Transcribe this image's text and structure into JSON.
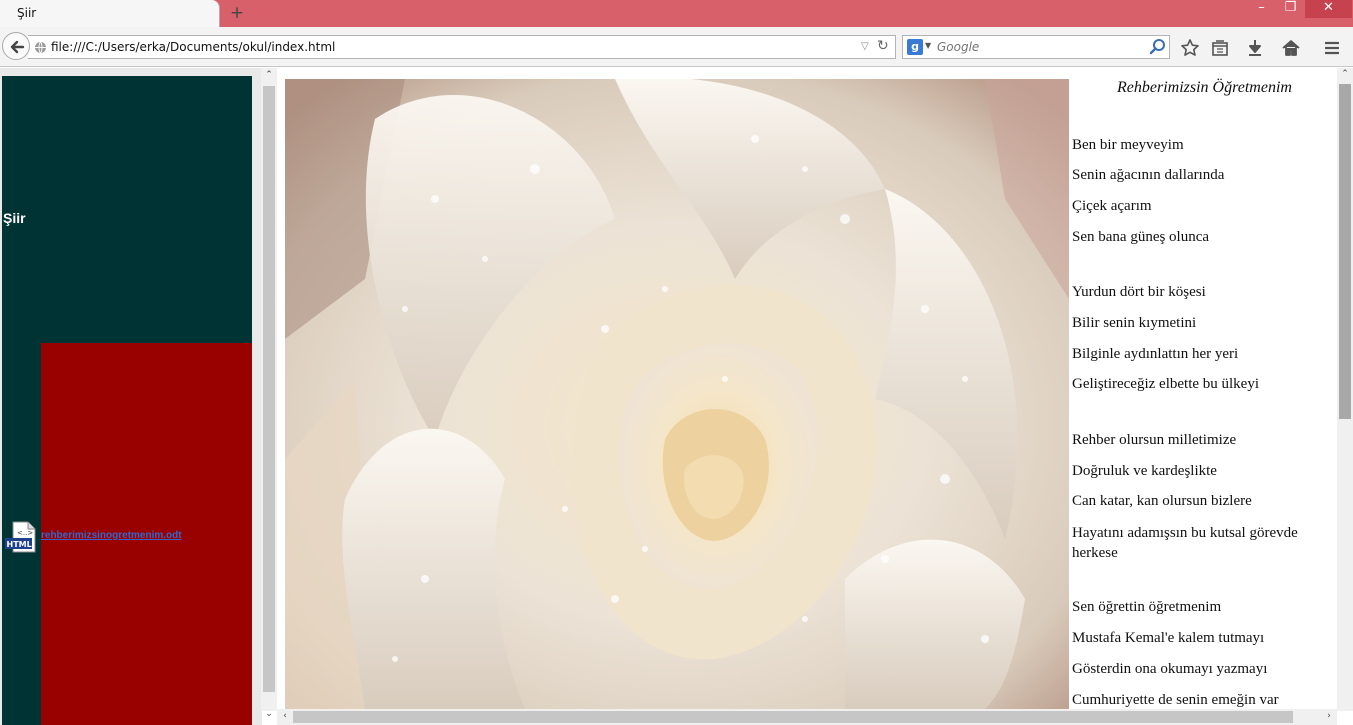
{
  "browser": {
    "tab_title": "Şiir",
    "new_tab_label": "+",
    "url": "file:///C:/Users/erka/Documents/okul/index.html",
    "search_engine_badge": "g",
    "search_placeholder": "Google",
    "window_controls": {
      "minimize": "–",
      "maximize": "❐",
      "close": "✕"
    }
  },
  "left_panel": {
    "heading": "Şiir",
    "file_link": "rehberimizsinogretmenim.odt",
    "file_icon_label": "HTML",
    "colors": {
      "top": "#003333",
      "bottom": "#990000"
    }
  },
  "poem": {
    "title": "Rehberimizsin Öğretmenim",
    "lines": [
      "Ben bir meyveyim",
      "Senin ağacının dallarında",
      "Çiçek açarım",
      "Sen bana güneş olunca",
      "Yurdun dört bir köşesi",
      "Bilir senin kıymetini",
      "Bilginle aydınlattın her yeri",
      "Geliştireceğiz elbette bu ülkeyi",
      "Rehber olursun milletimize",
      "Doğruluk ve kardeşlikte",
      "Can katar, kan olursun bizlere",
      "Hayatını adamışsın bu kutsal görevde herkese",
      "Sen öğrettin öğretmenim",
      "Mustafa Kemal'e kalem tutmayı",
      "Gösterdin ona okumayı yazmayı",
      "Cumhuriyette de senin emeğin var"
    ]
  }
}
